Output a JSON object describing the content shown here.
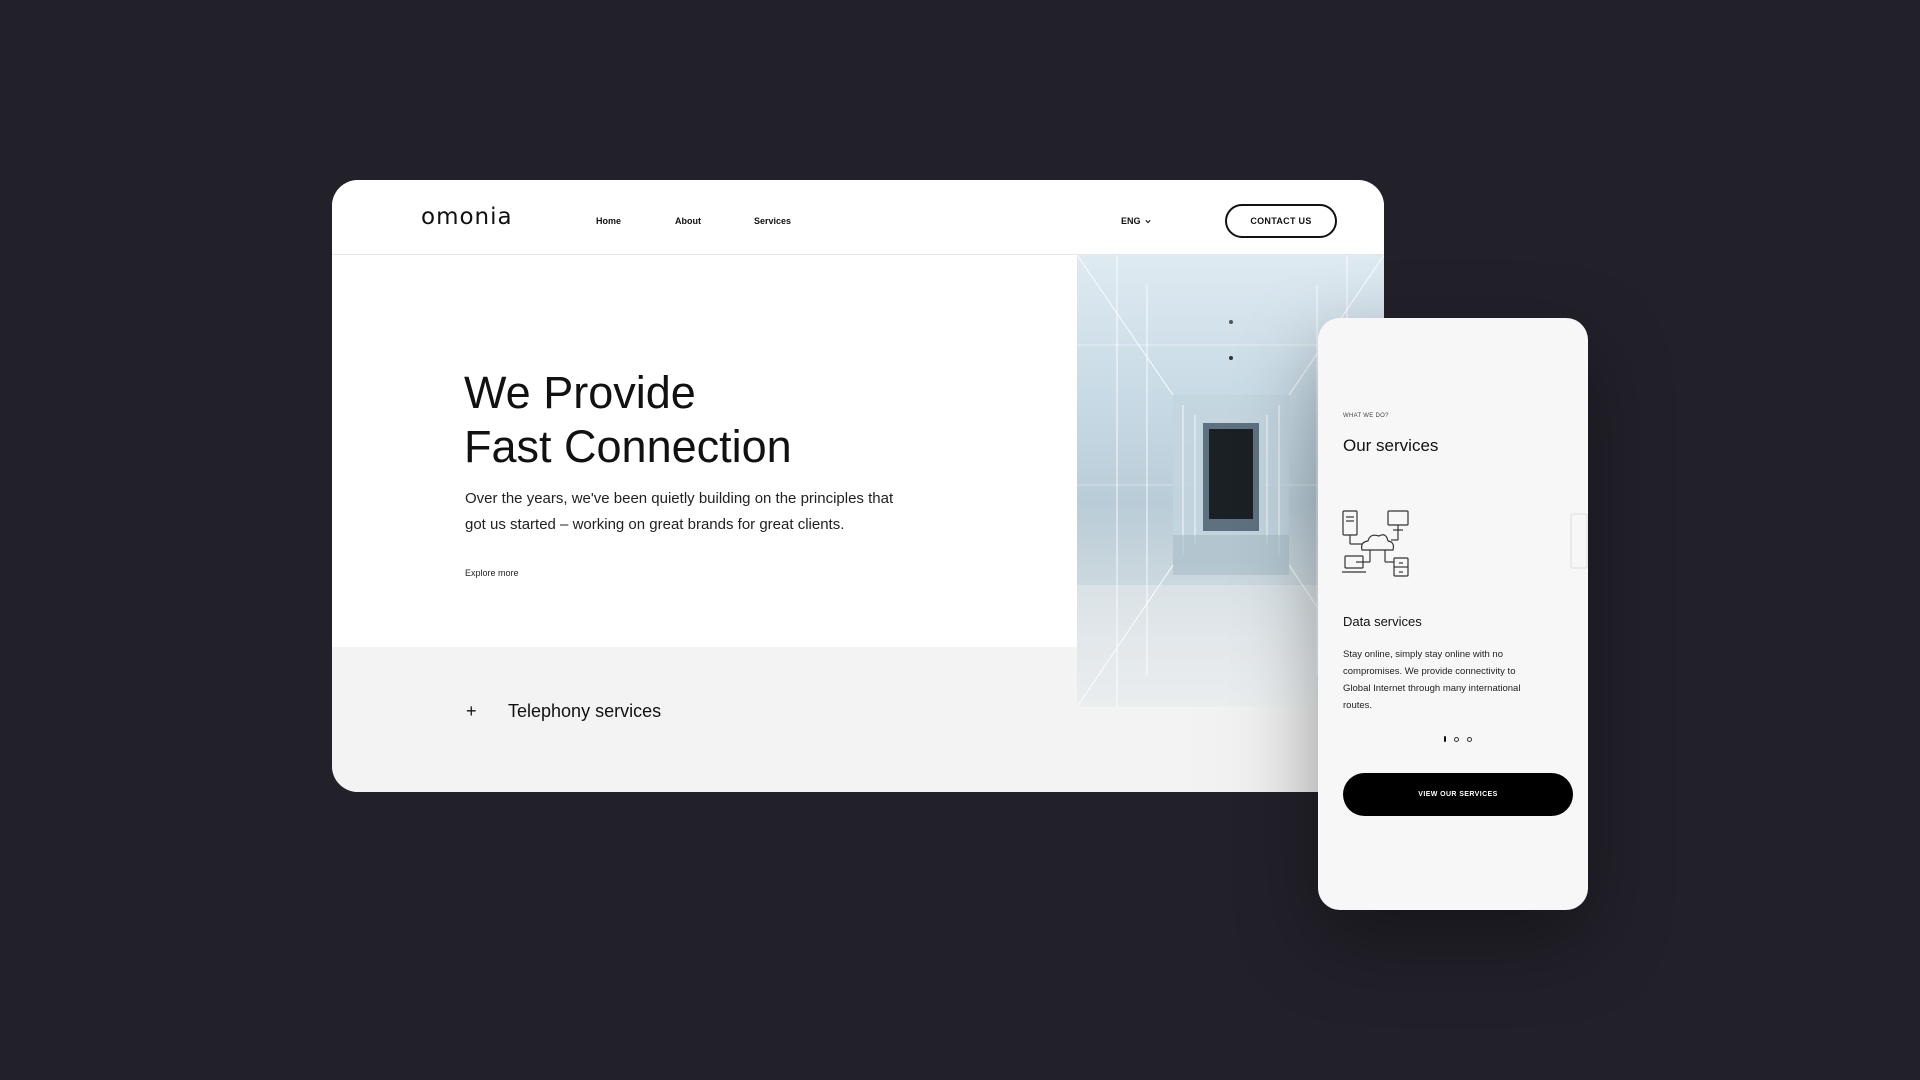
{
  "desktop": {
    "logo": "omonia",
    "nav": {
      "home": "Home",
      "about": "About",
      "services": "Services"
    },
    "language": "ENG",
    "contact_label": "CONTACT US",
    "hero": {
      "title_line1": "We Provide",
      "title_line2": "Fast Connection",
      "text": "Over the years, we've been quietly building on the principles that got us started – working on great brands for great clients.",
      "link": "Explore more"
    },
    "accordion": {
      "icon": "+",
      "label": "Telephony services"
    }
  },
  "mobile": {
    "eyebrow": "WHAT WE DO?",
    "title": "Our services",
    "card": {
      "icon": "network-cloud-icon",
      "title": "Data services",
      "text": "Stay online, simply stay online with no compromises. We provide connectivity to Global Internet through many international routes."
    },
    "pager": {
      "total": 3,
      "active": 1
    },
    "button_label": "VIEW OUR SERVICES"
  },
  "colors": {
    "background": "#22212a",
    "card": "#ffffff",
    "band": "#f3f3f3",
    "button": "#000000",
    "text": "#111111"
  }
}
